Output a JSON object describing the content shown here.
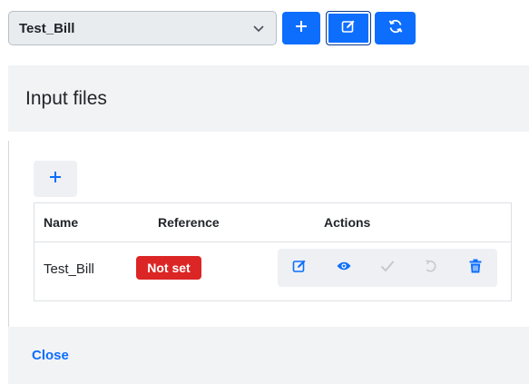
{
  "toolbar": {
    "select_value": "Test_Bill",
    "icons": {
      "dropdown": "chevron-down-icon",
      "add": "plus-icon",
      "edit": "edit-icon",
      "refresh": "refresh-icon"
    }
  },
  "panel": {
    "title": "Input files",
    "add_icon": "plus-icon",
    "table": {
      "headers": [
        "Name",
        "Reference",
        "Actions"
      ],
      "rows": [
        {
          "name": "Test_Bill",
          "reference": "Not set",
          "actions": [
            "edit-icon",
            "eye-icon",
            "check-icon",
            "undo-icon",
            "trash-icon"
          ]
        }
      ]
    },
    "close_label": "Close"
  },
  "colors": {
    "primary": "#0d6efd",
    "danger": "#dc2626",
    "disabled": "#c5c9ce",
    "panel_bg": "#f2f3f5"
  }
}
